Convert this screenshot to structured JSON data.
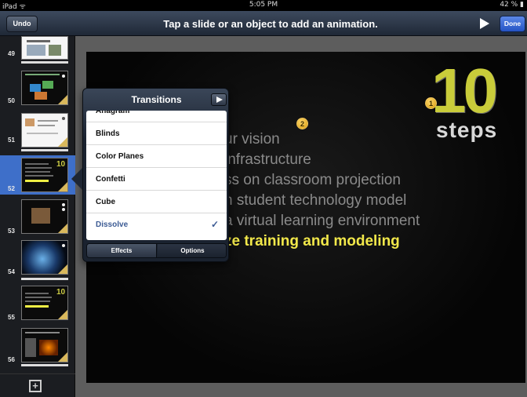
{
  "status_bar": {
    "carrier": "iPad ᯤ",
    "time": "5:05 PM",
    "battery": "42 % ▮"
  },
  "toolbar": {
    "undo_label": "Undo",
    "title": "Tap a slide or an object to add an animation.",
    "play_icon": "play-icon",
    "done_label": "Done"
  },
  "navigator": {
    "slides": [
      {
        "number": "49",
        "theme": "light"
      },
      {
        "number": "50",
        "theme": "dark"
      },
      {
        "number": "51",
        "theme": "light"
      },
      {
        "number": "52",
        "theme": "dark",
        "selected": true
      },
      {
        "number": "53",
        "theme": "dark"
      },
      {
        "number": "54",
        "theme": "dark"
      },
      {
        "number": "55",
        "theme": "dark"
      },
      {
        "number": "56",
        "theme": "dark"
      }
    ],
    "add_slide_icon": "plus-icon"
  },
  "slide": {
    "lines": [
      "ur vision",
      "infrastructure",
      "ss on classroom projection",
      "n student technology model",
      "a virtual learning environment",
      "ze training and modeling"
    ],
    "logo_number": "10",
    "logo_word": "steps",
    "badges": [
      "1",
      "2"
    ],
    "colors": {
      "highlight": "#f2e84a",
      "text": "#8a8a8a",
      "accent": "#d9b85c"
    }
  },
  "popover": {
    "title": "Transitions",
    "items": [
      "Anagram",
      "Blinds",
      "Color Planes",
      "Confetti",
      "Cube",
      "Dissolve"
    ],
    "selected_item": "Dissolve",
    "check_mark": "✓",
    "tabs": {
      "effects": "Effects",
      "options": "Options"
    }
  }
}
